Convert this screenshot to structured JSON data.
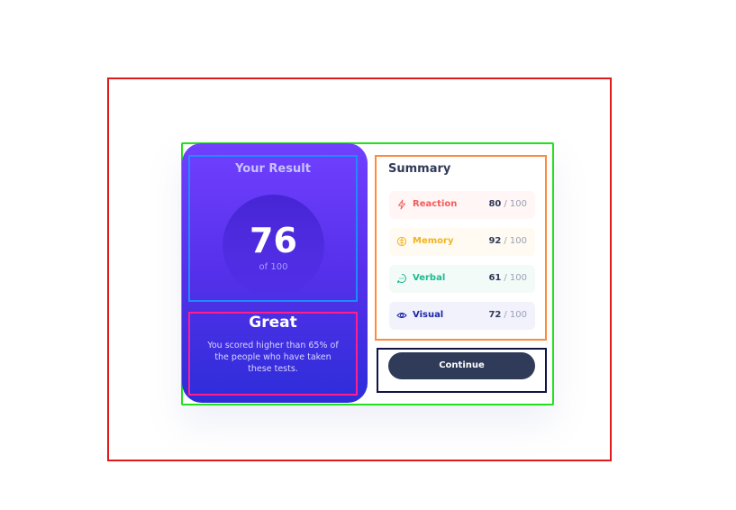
{
  "result": {
    "title": "Your Result",
    "score": "76",
    "score_of": "of 100",
    "rating": "Great",
    "description": "You scored higher than 65% of the people who have taken these tests."
  },
  "summary": {
    "title": "Summary",
    "items": [
      {
        "label": "Reaction",
        "score": "80",
        "max": "/ 100",
        "color": "#f55b5b",
        "icon": "lightning-icon"
      },
      {
        "label": "Memory",
        "score": "92",
        "max": "/ 100",
        "color": "#f2b320",
        "icon": "brain-icon"
      },
      {
        "label": "Verbal",
        "score": "61",
        "max": "/ 100",
        "color": "#1cbb8d",
        "icon": "chat-icon"
      },
      {
        "label": "Visual",
        "score": "72",
        "max": "/ 100",
        "color": "#1b27a8",
        "icon": "eye-icon"
      }
    ]
  },
  "actions": {
    "continue_label": "Continue"
  },
  "colors": {
    "gradient_top": "#7140ff",
    "gradient_bottom": "#2d2ed9",
    "button_bg": "#303b59"
  }
}
